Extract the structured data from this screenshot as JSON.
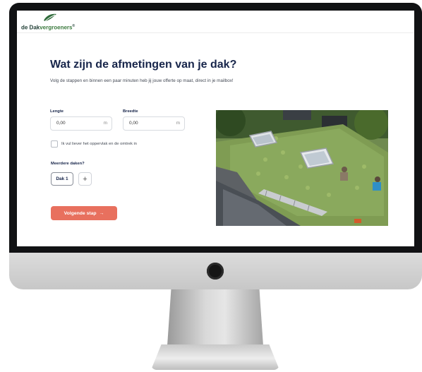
{
  "brand": {
    "prefix": "de Dak",
    "suffix": "vergroeners",
    "mark": "®"
  },
  "page": {
    "title": "Wat zijn de afmetingen van je dak?",
    "subtitle": "Volg de stappen en binnen een paar minuten heb jij jouw offerte op maat, direct in je mailbox!"
  },
  "form": {
    "length": {
      "label": "Lengte",
      "value": "0,00",
      "unit": "m"
    },
    "width": {
      "label": "Breedte",
      "value": "0,00",
      "unit": "m"
    },
    "area_option_label": "Ik vul liever het oppervlak en de omtrek in",
    "multiple_roofs_label": "Meerdere daken?",
    "roofs": [
      "Dak 1"
    ],
    "add_symbol": "+",
    "next_button": "Volgende stap",
    "next_arrow": "→"
  },
  "colors": {
    "accent": "#e8705e",
    "title": "#17254a",
    "brand_green": "#3b7a3e"
  }
}
